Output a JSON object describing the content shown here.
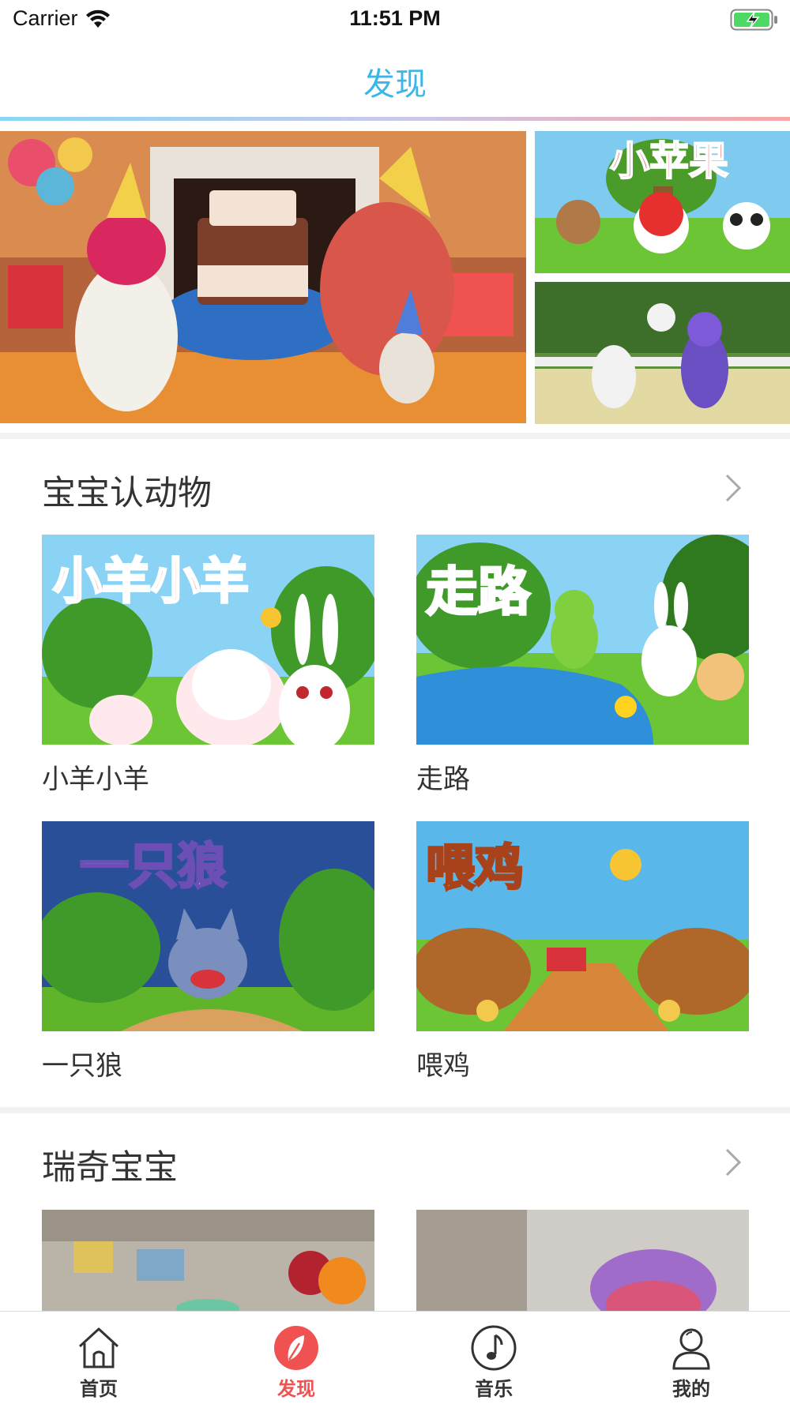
{
  "status_bar": {
    "carrier": "Carrier",
    "time": "11:51 PM"
  },
  "nav": {
    "title": "发现"
  },
  "colors": {
    "accent": "#3ab6e8",
    "active_tab": "#f05252",
    "battery": "#4cd964"
  },
  "banner": {
    "main_image": "birthday-party-cake-scene",
    "side_images": [
      {
        "title_art": "小苹果",
        "icon": "panda-monkey-apple-scene"
      },
      {
        "icon": "forest-dancing-animals-scene"
      }
    ]
  },
  "sections": [
    {
      "title": "宝宝认动物",
      "items": [
        {
          "label": "小羊小羊",
          "art_text": "小羊小羊",
          "icon": "lamb-rabbit-thumbnail"
        },
        {
          "label": "走路",
          "art_text": "走路",
          "icon": "turtle-rabbit-thumbnail"
        },
        {
          "label": "一只狼",
          "art_text": "一只狼",
          "icon": "wolf-thumbnail"
        },
        {
          "label": "喂鸡",
          "art_text": "喂鸡",
          "icon": "cows-thumbnail"
        }
      ]
    },
    {
      "title": "瑞奇宝宝",
      "items": [
        {
          "icon": "toy-blocks-thumbnail"
        },
        {
          "icon": "purple-toy-thumbnail"
        }
      ]
    }
  ],
  "tabs": [
    {
      "label": "首页",
      "icon": "home-icon",
      "active": false
    },
    {
      "label": "发现",
      "icon": "discover-icon",
      "active": true
    },
    {
      "label": "音乐",
      "icon": "music-icon",
      "active": false
    },
    {
      "label": "我的",
      "icon": "profile-icon",
      "active": false
    }
  ]
}
